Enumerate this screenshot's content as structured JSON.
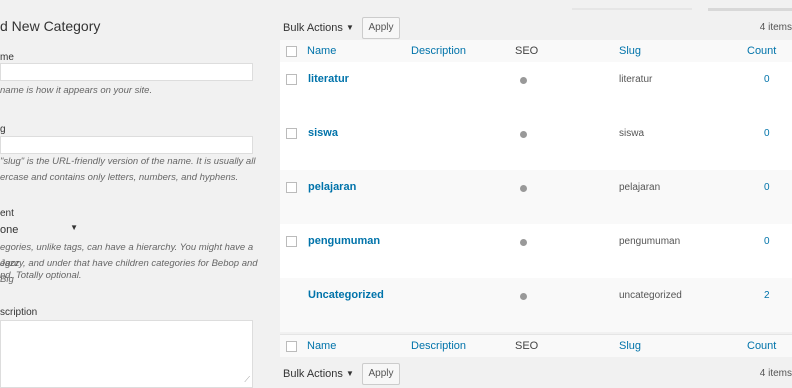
{
  "add_category": {
    "title": "d New Category",
    "name_label": "me",
    "name_help": "name is how it appears on your site.",
    "slug_label": "g",
    "slug_help_1": "\"slug\" is the URL-friendly version of the name. It is usually all",
    "slug_help_2": "ercase and contains only letters, numbers, and hyphens.",
    "parent_label": "ent",
    "parent_value": "one",
    "parent_help_1": "egories, unlike tags, can have a hierarchy. You might have a Jazz",
    "parent_help_2": "egory, and under that have children categories for Bebop and Big",
    "parent_help_3": "nd. Totally optional.",
    "description_label": "scription"
  },
  "toolbar": {
    "bulk_actions": "Bulk Actions",
    "apply": "Apply",
    "items_count_top": "4 items",
    "items_count_bottom": "4 items"
  },
  "table": {
    "columns": [
      "Name",
      "Description",
      "SEO",
      "Slug",
      "Count"
    ],
    "rows": [
      {
        "name": "literatur",
        "slug": "literatur",
        "count": "0",
        "checkbox": true
      },
      {
        "name": "siswa",
        "slug": "siswa",
        "count": "0",
        "checkbox": true
      },
      {
        "name": "pelajaran",
        "slug": "pelajaran",
        "count": "0",
        "checkbox": true
      },
      {
        "name": "pengumuman",
        "slug": "pengumuman",
        "count": "0",
        "checkbox": true
      },
      {
        "name": "Uncategorized",
        "slug": "uncategorized",
        "count": "2",
        "checkbox": false
      }
    ]
  },
  "colors": {
    "link": "#0073aa",
    "background": "#f1f1f1",
    "seo_dot": "#999999"
  },
  "icons": {
    "select_arrow": "caret-down-icon",
    "seo_status": "dot-icon",
    "textarea_resize": "resize-handle-icon"
  }
}
